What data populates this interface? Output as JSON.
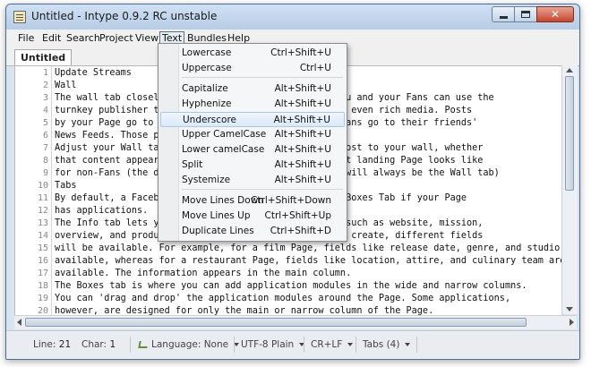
{
  "window": {
    "title": "Untitled - Intype 0.9.2 RC unstable"
  },
  "menu": [
    "File",
    "Edit",
    "Search",
    "Project",
    "View",
    "Text",
    "Bundles",
    "Help"
  ],
  "active_menu_index": 5,
  "tab": {
    "label": "Untitled"
  },
  "editor": {
    "line_numbers": [
      "1",
      "2",
      "3",
      "4",
      "5",
      "6",
      "7",
      "8",
      "9",
      "10",
      "11",
      "12",
      "13",
      "14",
      "15",
      "16",
      "17",
      "18",
      "19",
      "20"
    ],
    "lines": [
      "Update Streams",
      "Wall",
      "The wall tab closely                       profile You and your Fans can use the",
      "turnkey publisher to                       mments and even rich media. Posts",
      "by your Page go to y                        by your Fans go to their friends'",
      "News Feeds. Those po                       age.",
      "Adjust your Wall tab                       Fans can post to your wall, whether",
      "that content appears                       the default landing Page looks like",
      "for non-Fans (the de                        visitors will always be the Wall tab)",
      "Tabs",
      "By default, a Facebo                       Tab and a Boxes Tab if your Page",
      "has applications.",
      "The Info tab lets yo                       r company such as website, mission,",
      "overview, and produc                       f Page you create, different fields",
      "will be available. For example, for a film Page, fields like release date, genre, and studio a",
      "available, whereas for a restaurant Page, fields like location, attire, and culinary team are",
      "available. The information appears in the main column.",
      "The Boxes tab is where you can add application modules in the wide and narrow columns.",
      "You can 'drag and drop' the application modules around the Page. Some applications,",
      "however, are designed for only the main or narrow column of the Page."
    ]
  },
  "text_menu": {
    "items": [
      {
        "label": "Lowercase",
        "shortcut": "Ctrl+Shift+U"
      },
      {
        "label": "Uppercase",
        "shortcut": "Ctrl+U"
      },
      {
        "label": "Capitalize",
        "shortcut": "Alt+Shift+U"
      },
      {
        "label": "Hyphenize",
        "shortcut": "Alt+Shift+U"
      },
      {
        "label": "Underscore",
        "shortcut": "Alt+Shift+U"
      },
      {
        "label": "Upper CamelCase",
        "shortcut": "Alt+Shift+U"
      },
      {
        "label": "Lower camelCase",
        "shortcut": "Alt+Shift+U"
      },
      {
        "label": "Split",
        "shortcut": "Alt+Shift+U"
      },
      {
        "label": "Systemize",
        "shortcut": "Alt+Shift+U"
      },
      {
        "label": "Move Lines Down",
        "shortcut": "Ctrl+Shift+Down"
      },
      {
        "label": "Move Lines Up",
        "shortcut": "Ctrl+Shift+Up"
      },
      {
        "label": "Duplicate Lines",
        "shortcut": "Ctrl+Shift+D"
      }
    ],
    "hovered_index": 4
  },
  "status": {
    "line_label": "Line:",
    "line_value": "21",
    "char_label": "Char:",
    "char_value": "1",
    "language": "Language: None",
    "encoding": "UTF-8 Plain",
    "line_ending": "CR+LF",
    "tabs": "Tabs (4)"
  }
}
